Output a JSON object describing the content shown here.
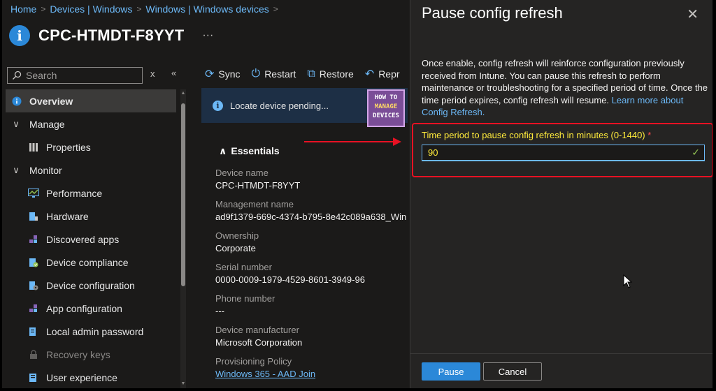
{
  "breadcrumb": [
    "Home",
    "Devices | Windows",
    "Windows | Windows devices"
  ],
  "page_title": "CPC-HTMDT-F8YYT",
  "title_more": "···",
  "search": {
    "placeholder": "Search"
  },
  "sidebar": {
    "items": [
      {
        "label": "Overview",
        "icon": "info-icon",
        "active": true
      },
      {
        "label": "Manage",
        "icon": "chevron-down-icon",
        "group": true
      },
      {
        "label": "Properties",
        "icon": "properties-icon"
      },
      {
        "label": "Monitor",
        "icon": "chevron-down-icon",
        "group": true
      },
      {
        "label": "Performance",
        "icon": "performance-icon"
      },
      {
        "label": "Hardware",
        "icon": "hardware-icon"
      },
      {
        "label": "Discovered apps",
        "icon": "apps-icon"
      },
      {
        "label": "Device compliance",
        "icon": "compliance-icon"
      },
      {
        "label": "Device configuration",
        "icon": "configuration-icon"
      },
      {
        "label": "App configuration",
        "icon": "app-config-icon"
      },
      {
        "label": "Local admin password",
        "icon": "password-icon"
      },
      {
        "label": "Recovery keys",
        "icon": "key-icon",
        "disabled": true
      },
      {
        "label": "User experience",
        "icon": "user-experience-icon"
      }
    ]
  },
  "toolbar": {
    "sync": "Sync",
    "restart": "Restart",
    "restore": "Restore",
    "reprovision": "Repr"
  },
  "infobar": {
    "text": "Locate device pending..."
  },
  "logo": {
    "line1": "HOW TO",
    "line2": "MANAGE",
    "line3": "DEVICES"
  },
  "essentials": {
    "title": "Essentials",
    "properties": [
      {
        "label": "Device name",
        "value": "CPC-HTMDT-F8YYT"
      },
      {
        "label": "Management name",
        "value": "ad9f1379-669c-4374-b795-8e42c089a638_Win"
      },
      {
        "label": "Ownership",
        "value": "Corporate"
      },
      {
        "label": "Serial number",
        "value": "0000-0009-1979-4529-8601-3949-96"
      },
      {
        "label": "Phone number",
        "value": "---"
      },
      {
        "label": "Device manufacturer",
        "value": "Microsoft Corporation"
      },
      {
        "label": "Provisioning Policy",
        "value": "Windows 365 - AAD Join"
      }
    ]
  },
  "panel": {
    "title": "Pause config refresh",
    "description": "Once enable, config refresh will reinforce configuration previously received from Intune. You can pause this refresh to perform maintenance or troubleshooting for a specified period of time. Once the time period expires, config refresh will resume.",
    "learn_more": "Learn more about Config Refresh.",
    "field_label": "Time period to pause config refresh in minutes (0-1440)",
    "required_mark": "*",
    "field_value": "90",
    "pause_button": "Pause",
    "cancel_button": "Cancel"
  },
  "colors": {
    "accent": "#2b88d8",
    "link": "#6cb8f6",
    "highlight_border": "#e81123",
    "label_highlight": "#ffeb3b",
    "valid_check": "#92c353"
  }
}
